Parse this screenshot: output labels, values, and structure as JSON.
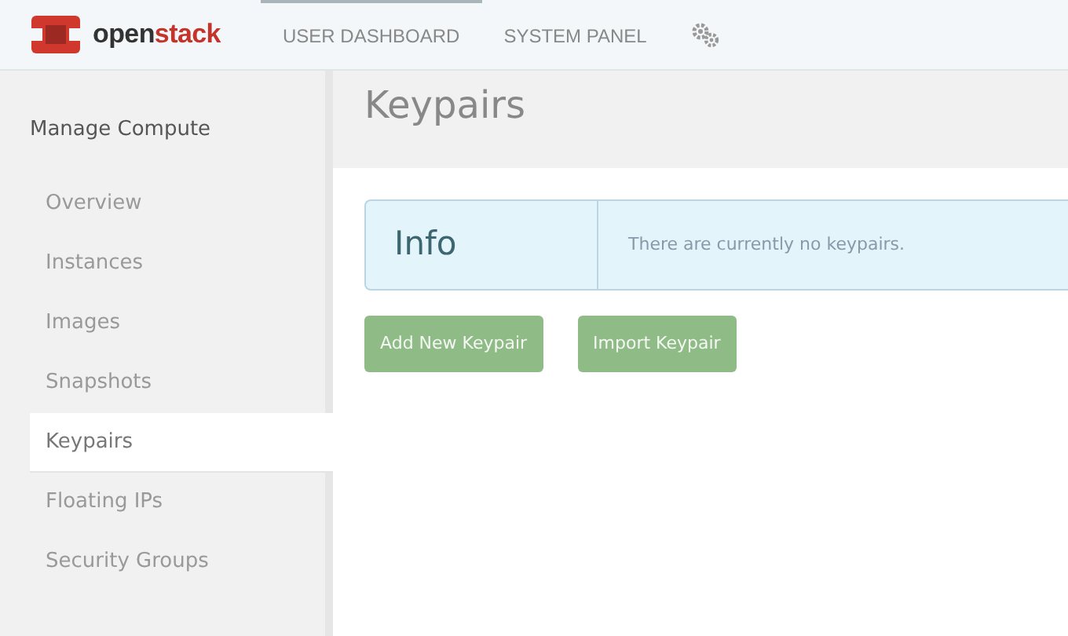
{
  "logo": {
    "parts": [
      {
        "text": "open",
        "kind": "base"
      },
      {
        "text": "stack",
        "kind": "accent"
      }
    ]
  },
  "top_tabs": [
    {
      "label": "USER DASHBOARD",
      "selected": true
    },
    {
      "label": "SYSTEM PANEL",
      "selected": false
    }
  ],
  "sidebar": {
    "heading": "Manage Compute",
    "items": [
      {
        "label": "Overview",
        "selected": false
      },
      {
        "label": "Instances",
        "selected": false
      },
      {
        "label": "Images",
        "selected": false
      },
      {
        "label": "Snapshots",
        "selected": false
      },
      {
        "label": "Keypairs",
        "selected": true
      },
      {
        "label": "Floating IPs",
        "selected": false
      },
      {
        "label": "Security Groups",
        "selected": false
      }
    ]
  },
  "page_title": "Keypairs",
  "info": {
    "title": "Info",
    "message": "There are currently no keypairs."
  },
  "buttons": [
    "Add New Keypair",
    "Import Keypair"
  ]
}
